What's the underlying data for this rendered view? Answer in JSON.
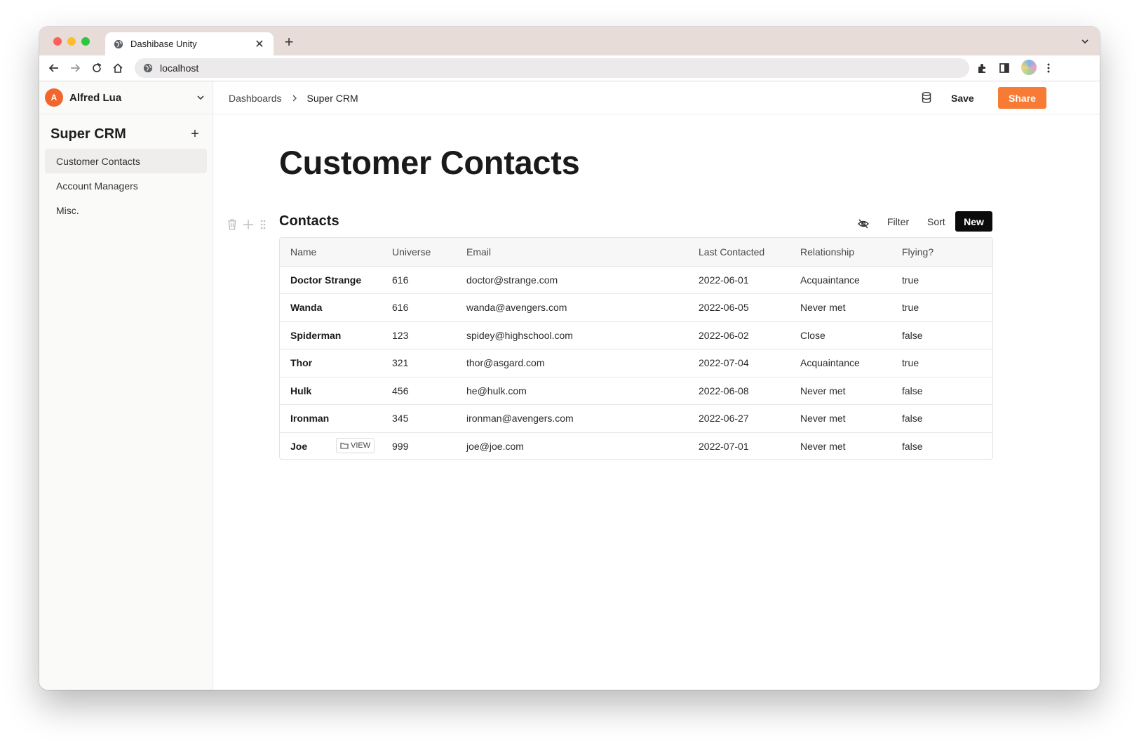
{
  "browser": {
    "tab_title": "Dashibase Unity",
    "tab_close": "✕",
    "new_tab": "+",
    "url": "localhost"
  },
  "sidebar": {
    "user": {
      "initial": "A",
      "name": "Alfred Lua",
      "avatar_color": "#f2662d"
    },
    "workspace_title": "Super CRM",
    "add_label": "+",
    "items": [
      {
        "label": "Customer Contacts",
        "active": true
      },
      {
        "label": "Account Managers",
        "active": false
      },
      {
        "label": "Misc.",
        "active": false
      }
    ]
  },
  "header": {
    "breadcrumb": {
      "parent": "Dashboards",
      "current": "Super CRM"
    },
    "save_label": "Save",
    "share_label": "Share",
    "share_color": "#f77a35"
  },
  "page": {
    "title": "Customer Contacts",
    "section": {
      "title": "Contacts",
      "filter_label": "Filter",
      "sort_label": "Sort",
      "new_label": "New",
      "view_label": "VIEW"
    }
  },
  "table": {
    "columns": [
      "Name",
      "Universe",
      "Email",
      "Last Contacted",
      "Relationship",
      "Flying?"
    ],
    "rows": [
      [
        "Doctor Strange",
        "616",
        "doctor@strange.com",
        "2022-06-01",
        "Acquaintance",
        "true"
      ],
      [
        "Wanda",
        "616",
        "wanda@avengers.com",
        "2022-06-05",
        "Never met",
        "true"
      ],
      [
        "Spiderman",
        "123",
        "spidey@highschool.com",
        "2022-06-02",
        "Close",
        "false"
      ],
      [
        "Thor",
        "321",
        "thor@asgard.com",
        "2022-07-04",
        "Acquaintance",
        "true"
      ],
      [
        "Hulk",
        "456",
        "he@hulk.com",
        "2022-06-08",
        "Never met",
        "false"
      ],
      [
        "Ironman",
        "345",
        "ironman@avengers.com",
        "2022-06-27",
        "Never met",
        "false"
      ],
      [
        "Joe",
        "999",
        "joe@joe.com",
        "2022-07-01",
        "Never met",
        "false"
      ]
    ]
  }
}
